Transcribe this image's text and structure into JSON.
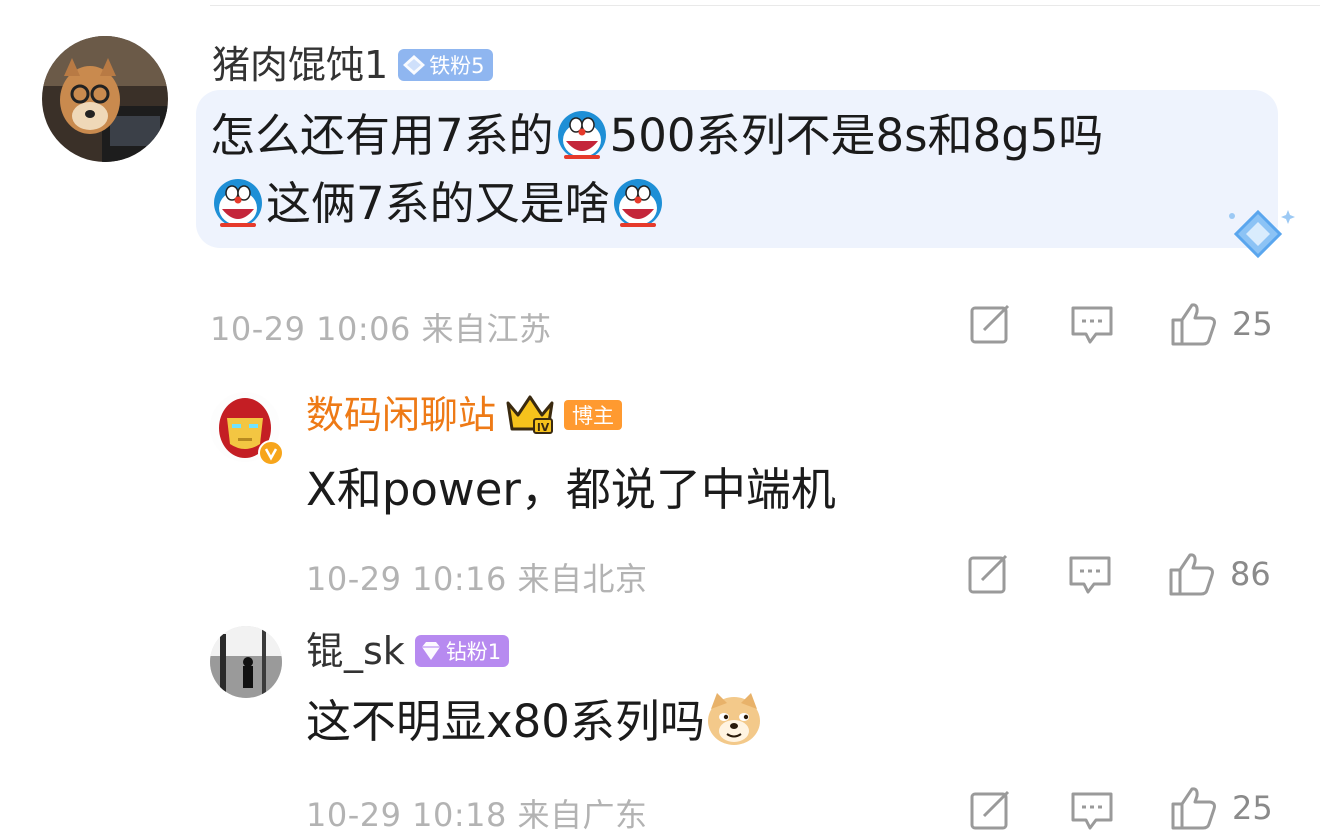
{
  "comments": [
    {
      "username": "猪肉馄饨1",
      "badge": "铁粉5",
      "text_line1": [
        "怎么还有用7系的",
        "500系列不是8s和8g5吗"
      ],
      "text_line2": [
        "这俩7系的又是啥"
      ],
      "emoji": "doraemon-laugh",
      "time": "10-29 10:06",
      "location": "来自江苏",
      "likes": "25",
      "accent": "#eef3fd"
    },
    {
      "username": "数码闲聊站",
      "badge": "博主",
      "text": "X和power，都说了中端机",
      "time": "10-29 10:16",
      "location": "来自北京",
      "likes": "86",
      "accent": "#ee7a16"
    },
    {
      "username": "锟_sk",
      "badge": "钻粉1",
      "text": "这不明显x80系列吗",
      "emoji": "doge",
      "time": "10-29 10:18",
      "location": "来自广东",
      "likes": "25"
    }
  ],
  "icons": [
    "share-icon",
    "reply-icon",
    "thumb-up-icon"
  ]
}
